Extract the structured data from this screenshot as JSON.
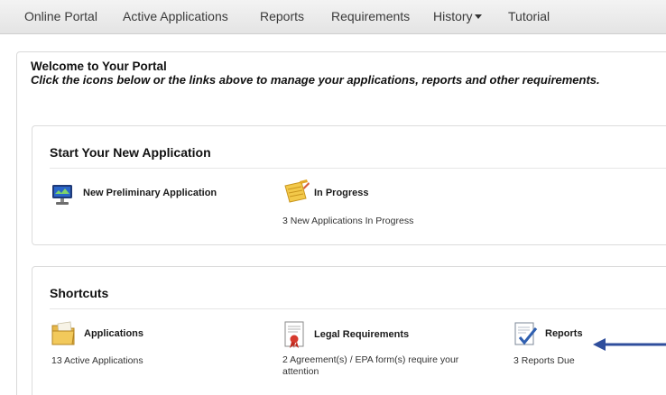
{
  "nav": {
    "items": [
      "Online Portal",
      "Active Applications",
      "Reports",
      "Requirements",
      "History",
      "Tutorial"
    ]
  },
  "welcome": {
    "title": "Welcome to Your Portal",
    "subtitle": "Click the icons below or the links above to manage your applications, reports and other requirements."
  },
  "start_panel": {
    "title": "Start Your New Application",
    "items": [
      {
        "label": "New Preliminary Application",
        "icon": "computer-monitor-icon"
      },
      {
        "label": "In Progress",
        "sub": "3 New Applications In Progress",
        "icon": "notepad-pencil-icon"
      }
    ]
  },
  "shortcuts_panel": {
    "title": "Shortcuts",
    "items": [
      {
        "label": "Applications",
        "sub": "13 Active Applications",
        "icon": "folder-icon"
      },
      {
        "label": "Legal Requirements",
        "sub_line1": "2 Agreement(s) / EPA form(s) require your",
        "sub_line2": "attention",
        "icon": "certificate-icon"
      },
      {
        "label": "Reports",
        "sub": "3 Reports Due",
        "icon": "report-checkmark-icon"
      }
    ]
  },
  "colors": {
    "arrow": "#2f4e9c",
    "navbar": "#e9e9e9"
  }
}
